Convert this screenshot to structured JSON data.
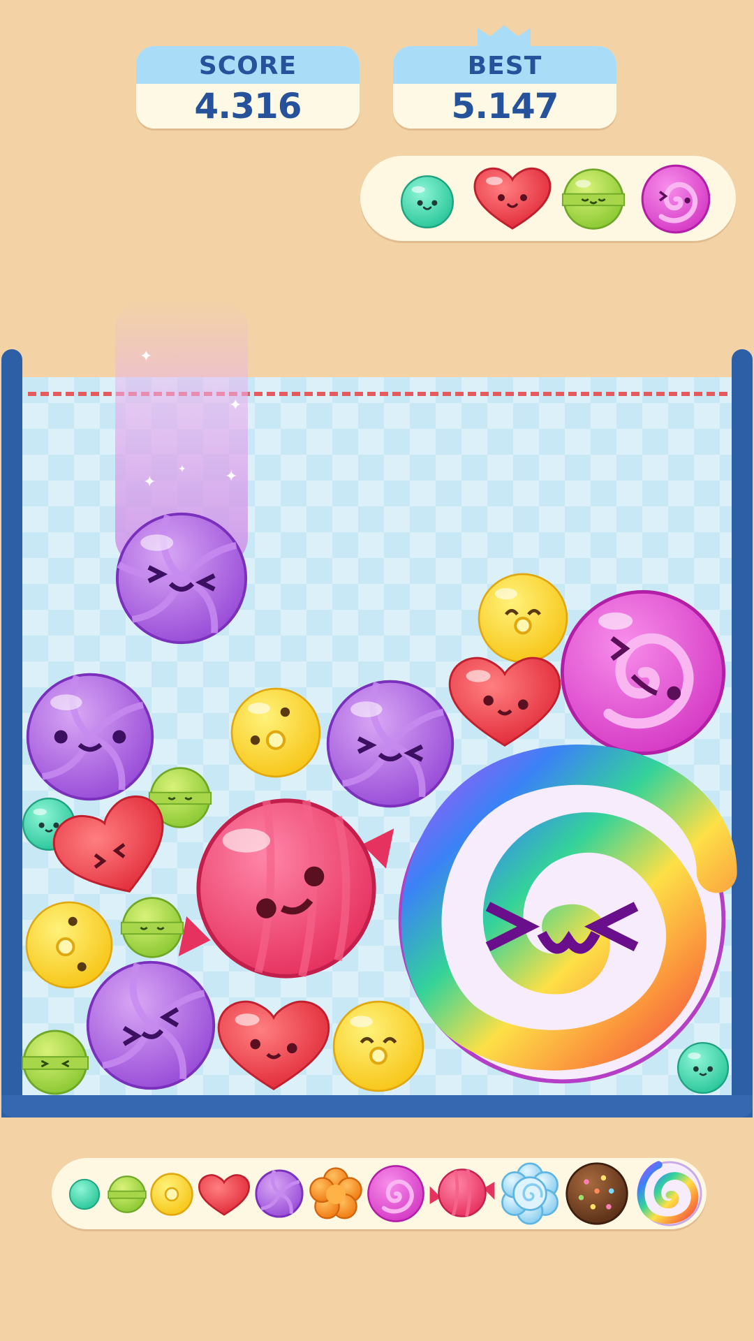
{
  "hud": {
    "score_label": "SCORE",
    "score_value": "4.316",
    "best_label": "BEST",
    "best_value": "5.147"
  },
  "next_queue": [
    "teal-candy",
    "red-heart-candy",
    "green-lollipop-candy",
    "magenta-swirl-candy"
  ],
  "falling_piece": "purple-swirl-candy",
  "candy_progression": [
    "teal-candy",
    "green-lollipop-candy",
    "yellow-donut-candy",
    "red-heart-candy",
    "purple-swirl-candy",
    "orange-flower-candy",
    "magenta-swirl-candy",
    "pink-wrapped-candy",
    "blue-meringue-candy",
    "chocolate-sprinkle-candy",
    "rainbow-swirl-candy"
  ],
  "colors": {
    "background": "#F3D2A6",
    "board_fill": "#C7E8F4",
    "board_wall": "#2C5FA6",
    "danger_line": "#E55A5C",
    "hud_text": "#25529A",
    "hud_label_fill": "#A9DDF7"
  }
}
